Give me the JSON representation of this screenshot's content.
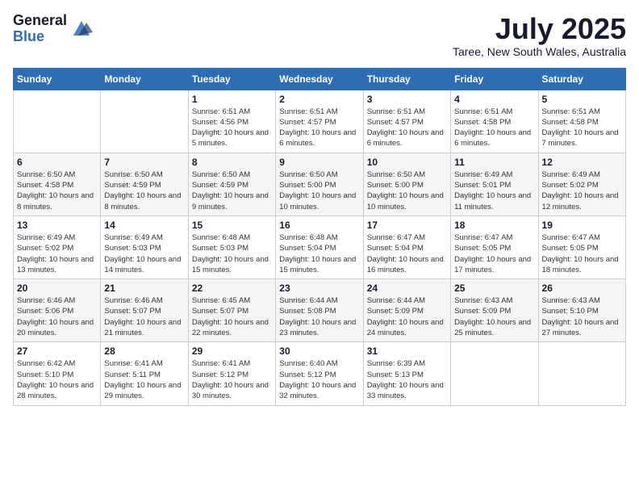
{
  "logo": {
    "general": "General",
    "blue": "Blue"
  },
  "title": "July 2025",
  "subtitle": "Taree, New South Wales, Australia",
  "days_of_week": [
    "Sunday",
    "Monday",
    "Tuesday",
    "Wednesday",
    "Thursday",
    "Friday",
    "Saturday"
  ],
  "weeks": [
    [
      {
        "day": "",
        "info": ""
      },
      {
        "day": "",
        "info": ""
      },
      {
        "day": "1",
        "info": "Sunrise: 6:51 AM\nSunset: 4:56 PM\nDaylight: 10 hours and 5 minutes."
      },
      {
        "day": "2",
        "info": "Sunrise: 6:51 AM\nSunset: 4:57 PM\nDaylight: 10 hours and 6 minutes."
      },
      {
        "day": "3",
        "info": "Sunrise: 6:51 AM\nSunset: 4:57 PM\nDaylight: 10 hours and 6 minutes."
      },
      {
        "day": "4",
        "info": "Sunrise: 6:51 AM\nSunset: 4:58 PM\nDaylight: 10 hours and 6 minutes."
      },
      {
        "day": "5",
        "info": "Sunrise: 6:51 AM\nSunset: 4:58 PM\nDaylight: 10 hours and 7 minutes."
      }
    ],
    [
      {
        "day": "6",
        "info": "Sunrise: 6:50 AM\nSunset: 4:58 PM\nDaylight: 10 hours and 8 minutes."
      },
      {
        "day": "7",
        "info": "Sunrise: 6:50 AM\nSunset: 4:59 PM\nDaylight: 10 hours and 8 minutes."
      },
      {
        "day": "8",
        "info": "Sunrise: 6:50 AM\nSunset: 4:59 PM\nDaylight: 10 hours and 9 minutes."
      },
      {
        "day": "9",
        "info": "Sunrise: 6:50 AM\nSunset: 5:00 PM\nDaylight: 10 hours and 10 minutes."
      },
      {
        "day": "10",
        "info": "Sunrise: 6:50 AM\nSunset: 5:00 PM\nDaylight: 10 hours and 10 minutes."
      },
      {
        "day": "11",
        "info": "Sunrise: 6:49 AM\nSunset: 5:01 PM\nDaylight: 10 hours and 11 minutes."
      },
      {
        "day": "12",
        "info": "Sunrise: 6:49 AM\nSunset: 5:02 PM\nDaylight: 10 hours and 12 minutes."
      }
    ],
    [
      {
        "day": "13",
        "info": "Sunrise: 6:49 AM\nSunset: 5:02 PM\nDaylight: 10 hours and 13 minutes."
      },
      {
        "day": "14",
        "info": "Sunrise: 6:49 AM\nSunset: 5:03 PM\nDaylight: 10 hours and 14 minutes."
      },
      {
        "day": "15",
        "info": "Sunrise: 6:48 AM\nSunset: 5:03 PM\nDaylight: 10 hours and 15 minutes."
      },
      {
        "day": "16",
        "info": "Sunrise: 6:48 AM\nSunset: 5:04 PM\nDaylight: 10 hours and 15 minutes."
      },
      {
        "day": "17",
        "info": "Sunrise: 6:47 AM\nSunset: 5:04 PM\nDaylight: 10 hours and 16 minutes."
      },
      {
        "day": "18",
        "info": "Sunrise: 6:47 AM\nSunset: 5:05 PM\nDaylight: 10 hours and 17 minutes."
      },
      {
        "day": "19",
        "info": "Sunrise: 6:47 AM\nSunset: 5:05 PM\nDaylight: 10 hours and 18 minutes."
      }
    ],
    [
      {
        "day": "20",
        "info": "Sunrise: 6:46 AM\nSunset: 5:06 PM\nDaylight: 10 hours and 20 minutes."
      },
      {
        "day": "21",
        "info": "Sunrise: 6:46 AM\nSunset: 5:07 PM\nDaylight: 10 hours and 21 minutes."
      },
      {
        "day": "22",
        "info": "Sunrise: 6:45 AM\nSunset: 5:07 PM\nDaylight: 10 hours and 22 minutes."
      },
      {
        "day": "23",
        "info": "Sunrise: 6:44 AM\nSunset: 5:08 PM\nDaylight: 10 hours and 23 minutes."
      },
      {
        "day": "24",
        "info": "Sunrise: 6:44 AM\nSunset: 5:09 PM\nDaylight: 10 hours and 24 minutes."
      },
      {
        "day": "25",
        "info": "Sunrise: 6:43 AM\nSunset: 5:09 PM\nDaylight: 10 hours and 25 minutes."
      },
      {
        "day": "26",
        "info": "Sunrise: 6:43 AM\nSunset: 5:10 PM\nDaylight: 10 hours and 27 minutes."
      }
    ],
    [
      {
        "day": "27",
        "info": "Sunrise: 6:42 AM\nSunset: 5:10 PM\nDaylight: 10 hours and 28 minutes."
      },
      {
        "day": "28",
        "info": "Sunrise: 6:41 AM\nSunset: 5:11 PM\nDaylight: 10 hours and 29 minutes."
      },
      {
        "day": "29",
        "info": "Sunrise: 6:41 AM\nSunset: 5:12 PM\nDaylight: 10 hours and 30 minutes."
      },
      {
        "day": "30",
        "info": "Sunrise: 6:40 AM\nSunset: 5:12 PM\nDaylight: 10 hours and 32 minutes."
      },
      {
        "day": "31",
        "info": "Sunrise: 6:39 AM\nSunset: 5:13 PM\nDaylight: 10 hours and 33 minutes."
      },
      {
        "day": "",
        "info": ""
      },
      {
        "day": "",
        "info": ""
      }
    ]
  ]
}
